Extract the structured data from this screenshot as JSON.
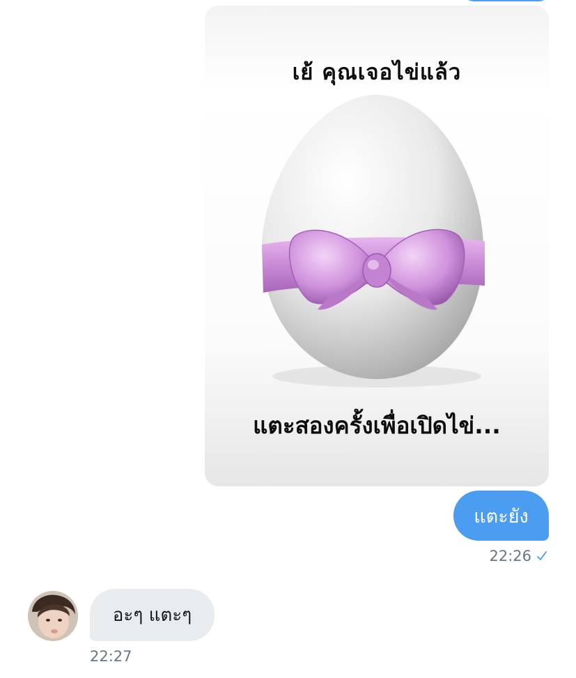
{
  "conversation": {
    "image_message": {
      "title": "เย้  คุณเจอไข่แล้ว",
      "caption": "แตะสองครั้งเพื่อเปิดไข่..."
    },
    "sent_message": {
      "text": "แตะยัง",
      "time": "22:26",
      "status_icon": "check-icon"
    },
    "received_message": {
      "text": "อะๆ แตะๆ",
      "time": "22:27"
    }
  },
  "colors": {
    "sent_bubble": "#4a9df1",
    "received_bubble": "#e9ecef",
    "meta_text": "#657786",
    "ribbon": "#d39be0"
  }
}
